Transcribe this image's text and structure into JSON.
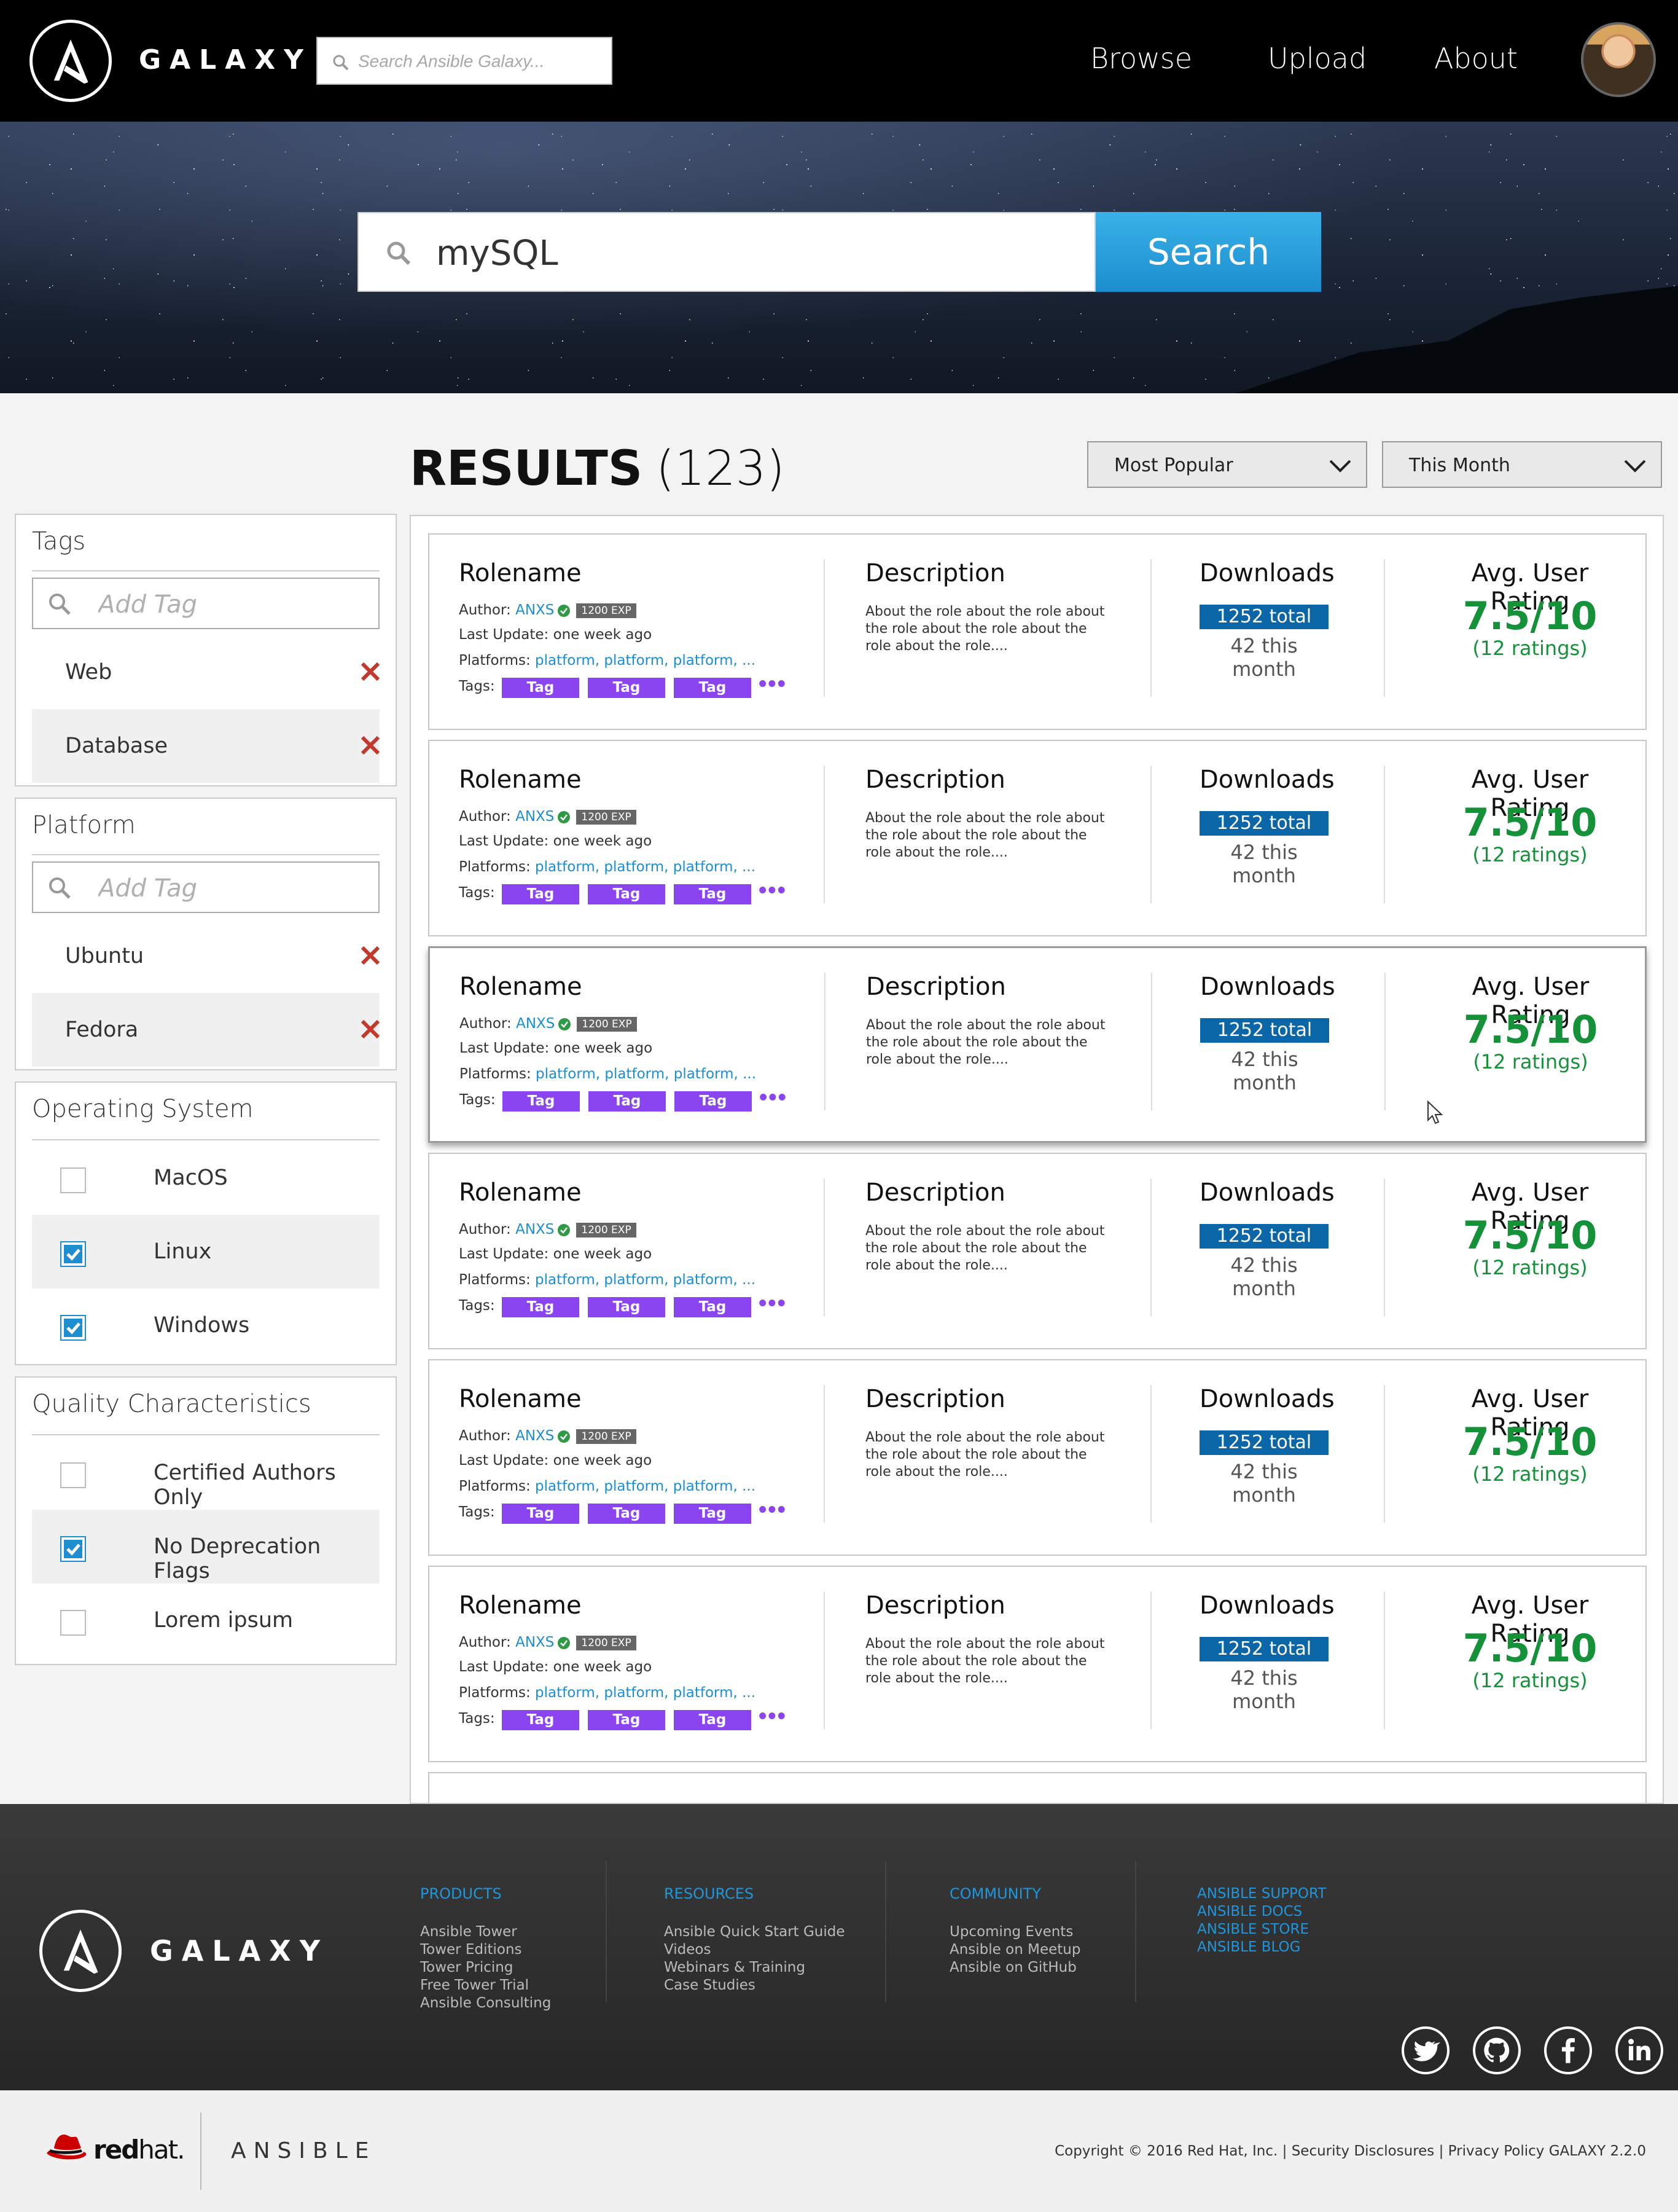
{
  "header": {
    "brand": "GALAXY",
    "search_placeholder": "Search Ansible Galaxy...",
    "nav": [
      "Browse",
      "Upload",
      "About"
    ]
  },
  "hero": {
    "query": "mySQL",
    "search_button": "Search"
  },
  "results": {
    "label": "RESULTS",
    "count": "(123)",
    "sort": "Most Popular",
    "period": "This Month"
  },
  "filters": {
    "tags": {
      "title": "Tags",
      "placeholder": "Add Tag",
      "items": [
        "Web",
        "Database"
      ]
    },
    "platform": {
      "title": "Platform",
      "placeholder": "Add Tag",
      "items": [
        "Ubuntu",
        "Fedora"
      ]
    },
    "os": {
      "title": "Operating System",
      "options": [
        {
          "label": "MacOS",
          "checked": false
        },
        {
          "label": "Linux",
          "checked": true
        },
        {
          "label": "Windows",
          "checked": true
        }
      ]
    },
    "quality": {
      "title": "Quality Characteristics",
      "options": [
        {
          "label": "Certified Authors Only",
          "checked": false
        },
        {
          "label": "No Deprecation Flags",
          "checked": true
        },
        {
          "label": "Lorem ipsum",
          "checked": false
        }
      ]
    }
  },
  "card_labels": {
    "author": "Author:",
    "last_update": "Last Update:",
    "platforms": "Platforms:",
    "tags": "Tags:",
    "description": "Description",
    "downloads": "Downloads",
    "rating": "Avg. User Rating",
    "more": "•••"
  },
  "cards": [
    {
      "rolename": "Rolename",
      "author": "ANXS",
      "exp": "1200 EXP",
      "updated": "one week ago",
      "platforms": "platform, platform, platform, ...",
      "tags": [
        "Tag",
        "Tag",
        "Tag"
      ],
      "description": "About the role about the role about the role  about the role about the role about the role....",
      "downloads_total": "1252 total",
      "downloads_month": "42 this month",
      "rating": "7.5/10",
      "ratings_count": "(12 ratings)"
    },
    {
      "rolename": "Rolename",
      "author": "ANXS",
      "exp": "1200 EXP",
      "updated": "one week ago",
      "platforms": "platform, platform, platform, ...",
      "tags": [
        "Tag",
        "Tag",
        "Tag"
      ],
      "description": "About the role about the role about the role  about the role about the role about the role....",
      "downloads_total": "1252 total",
      "downloads_month": "42 this month",
      "rating": "7.5/10",
      "ratings_count": "(12 ratings)"
    },
    {
      "rolename": "Rolename",
      "author": "ANXS",
      "exp": "1200 EXP",
      "updated": "one week ago",
      "platforms": "platform, platform, platform, ...",
      "tags": [
        "Tag",
        "Tag",
        "Tag"
      ],
      "description": "About the role about the role about the role  about the role about the role about the role....",
      "downloads_total": "1252 total",
      "downloads_month": "42 this month",
      "rating": "7.5/10",
      "ratings_count": "(12 ratings)",
      "selected": true
    },
    {
      "rolename": "Rolename",
      "author": "ANXS",
      "exp": "1200 EXP",
      "updated": "one week ago",
      "platforms": "platform, platform, platform, ...",
      "tags": [
        "Tag",
        "Tag",
        "Tag"
      ],
      "description": "About the role about the role about the role  about the role about the role about the role....",
      "downloads_total": "1252 total",
      "downloads_month": "42 this month",
      "rating": "7.5/10",
      "ratings_count": "(12 ratings)"
    },
    {
      "rolename": "Rolename",
      "author": "ANXS",
      "exp": "1200 EXP",
      "updated": "one week ago",
      "platforms": "platform, platform, platform, ...",
      "tags": [
        "Tag",
        "Tag",
        "Tag"
      ],
      "description": "About the role about the role about the role  about the role about the role about the role....",
      "downloads_total": "1252 total",
      "downloads_month": "42 this month",
      "rating": "7.5/10",
      "ratings_count": "(12 ratings)"
    },
    {
      "rolename": "Rolename",
      "author": "ANXS",
      "exp": "1200 EXP",
      "updated": "one week ago",
      "platforms": "platform, platform, platform, ...",
      "tags": [
        "Tag",
        "Tag",
        "Tag"
      ],
      "description": "About the role about the role about the role  about the role about the role about the role....",
      "downloads_total": "1252 total",
      "downloads_month": "42 this month",
      "rating": "7.5/10",
      "ratings_count": "(12 ratings)"
    }
  ],
  "footer": {
    "brand": "GALAXY",
    "products": {
      "heading": "PRODUCTS",
      "items": [
        "Ansible Tower",
        "Tower Editions",
        "Tower Pricing",
        "Free Tower Trial",
        "Ansible Consulting"
      ]
    },
    "resources": {
      "heading": "RESOURCES",
      "items": [
        "Ansible Quick Start Guide",
        "Videos",
        "Webinars & Training",
        "Case Studies"
      ]
    },
    "community": {
      "heading": "COMMUNITY",
      "items": [
        "Upcoming Events",
        "Ansible on Meetup",
        "Ansible on GitHub"
      ]
    },
    "support_links": [
      "ANSIBLE SUPPORT",
      "ANSIBLE DOCS",
      "ANSIBLE STORE",
      "ANSIBLE BLOG"
    ],
    "social_icons": [
      "twitter-icon",
      "github-icon",
      "facebook-icon",
      "linkedin-icon"
    ]
  },
  "subfooter": {
    "redhat_bold": "red",
    "redhat_thin": "hat.",
    "ansible": "ANSIBLE",
    "copyright": "Copyright © 2016 Red Hat, Inc. | Security Disclosures | Privacy Policy GALAXY 2.2.0"
  },
  "colors": {
    "accent": "#1e96dc",
    "tag": "#8a45f0",
    "downloads": "#0b66a8",
    "rating": "#15913a",
    "remove": "#c0392b"
  }
}
